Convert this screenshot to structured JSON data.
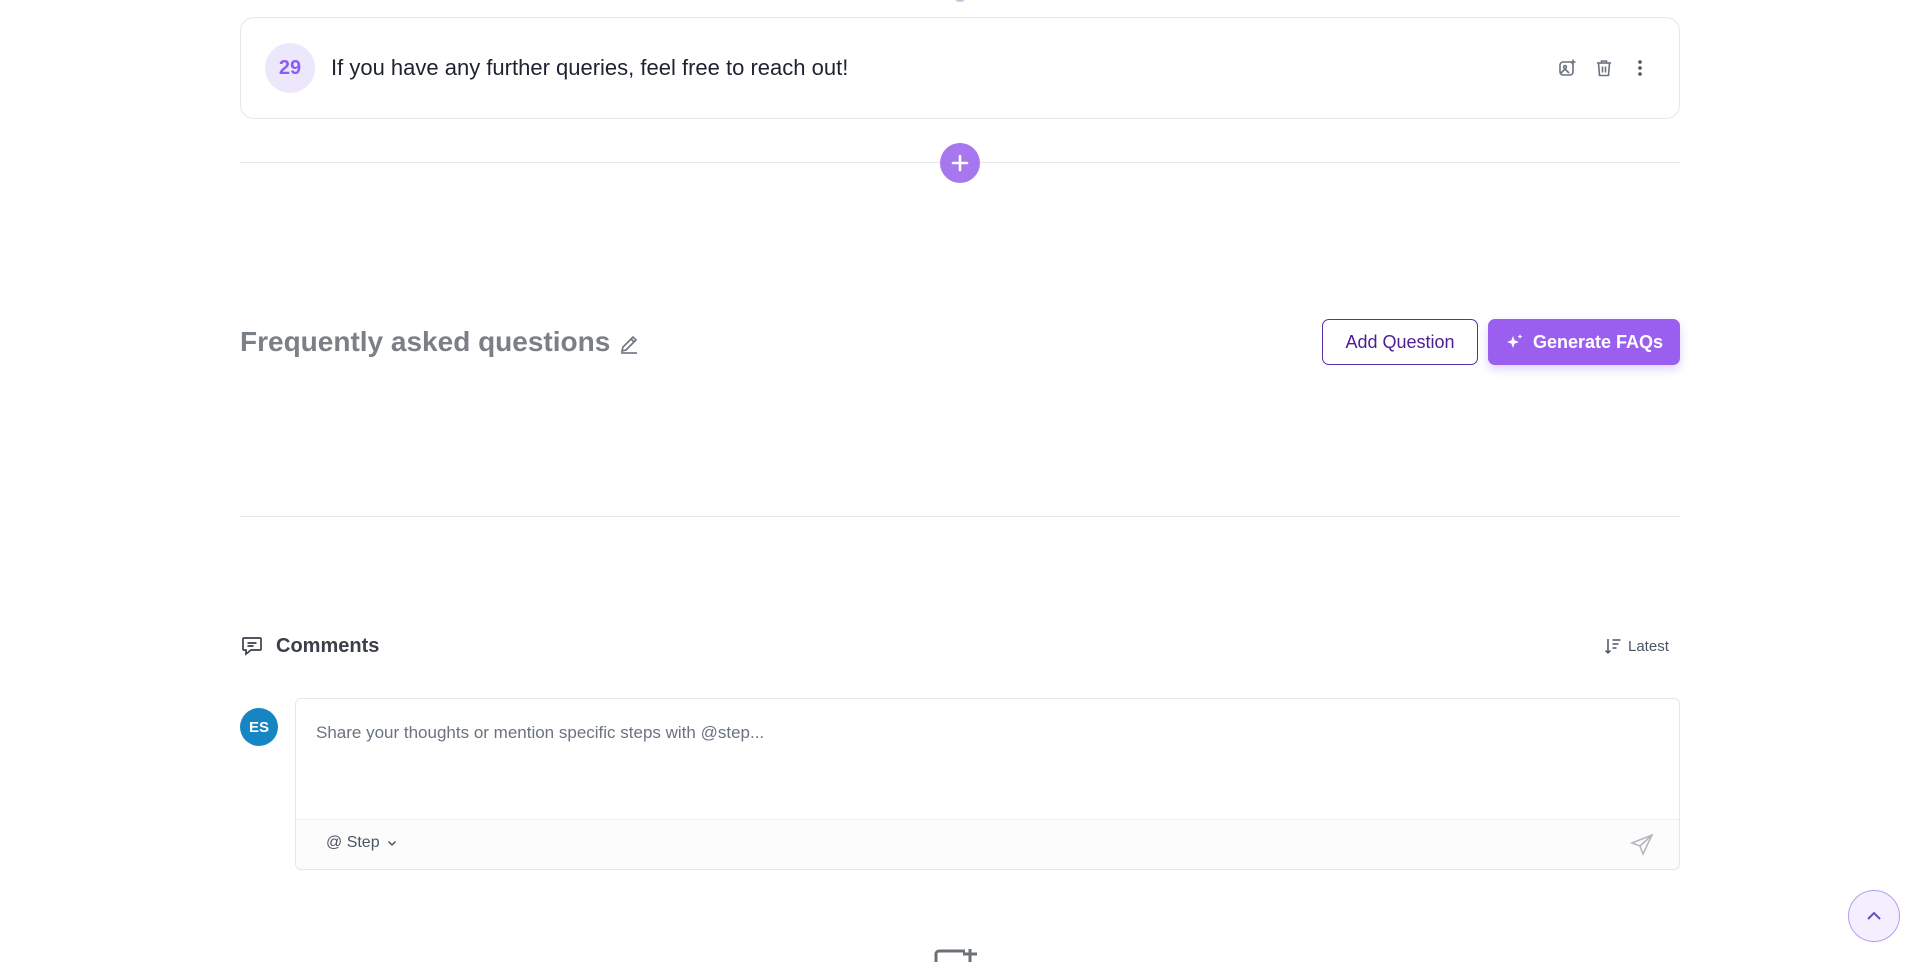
{
  "step": {
    "number": "29",
    "text": "If you have any further queries, feel free to reach out!"
  },
  "step_actions": {
    "icons": [
      "image-add-icon",
      "trash-icon",
      "more-vertical-icon"
    ]
  },
  "faq": {
    "title": "Frequently asked questions",
    "add_question_label": "Add Question",
    "generate_label": "Generate FAQs"
  },
  "comments": {
    "title": "Comments",
    "sort_label": "Latest",
    "avatar_initials": "ES",
    "placeholder": "Share your thoughts or mention specific steps with @step...",
    "mention_label": "@ Step"
  },
  "colors": {
    "accent": "#9b5ff0",
    "accent_dark": "#4c1d95",
    "avatar_bg": "#1686c2",
    "badge_bg": "#ede7fb"
  }
}
